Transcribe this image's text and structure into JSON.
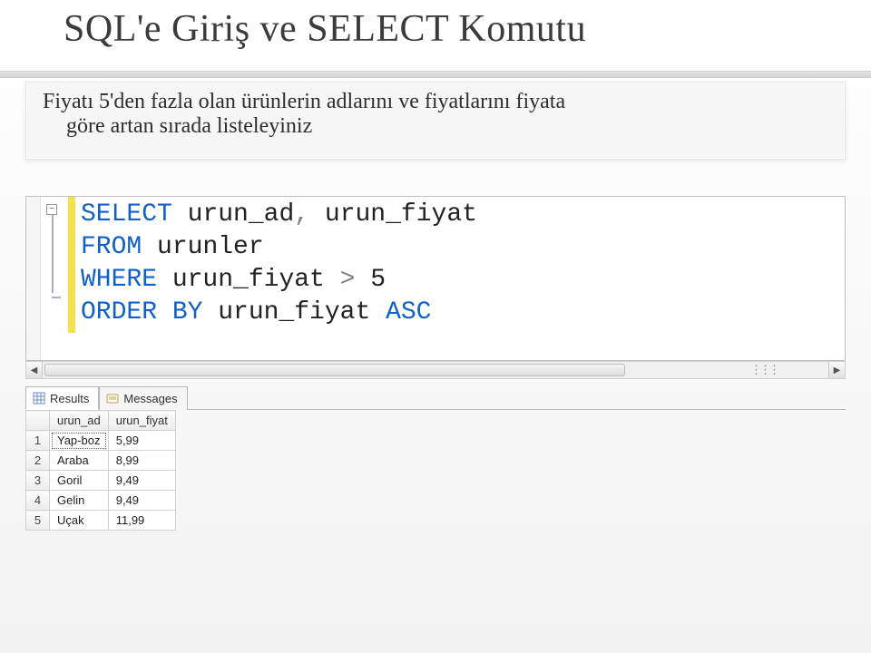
{
  "title": "SQL'e Giriş ve SELECT Komutu",
  "description": {
    "line1": "Fiyatı 5'den fazla olan ürünlerin adlarını ve fiyatlarını fiyata",
    "line2": "göre artan sırada listeleyiniz"
  },
  "sql": {
    "kw_select": "SELECT",
    "col1": "urun_ad",
    "comma": ",",
    "col2": "urun_fiyat",
    "kw_from": "FROM",
    "table": "urunler",
    "kw_where": "WHERE",
    "where_col": "urun_fiyat",
    "op": ">",
    "val": "5",
    "kw_orderby": "ORDER BY",
    "order_col": "urun_fiyat",
    "kw_asc": "ASC",
    "fold_symbol": "−"
  },
  "scroll": {
    "left_glyph": "◀",
    "right_glyph": "▶",
    "marks": "⋮⋮⋮"
  },
  "tabs": {
    "results": "Results",
    "messages": "Messages"
  },
  "grid": {
    "headers": {
      "c1": "urun_ad",
      "c2": "urun_fiyat"
    },
    "rows": [
      {
        "n": "1",
        "c1": "Yap-boz",
        "c2": "5,99"
      },
      {
        "n": "2",
        "c1": "Araba",
        "c2": "8,99"
      },
      {
        "n": "3",
        "c1": "Goril",
        "c2": "9,49"
      },
      {
        "n": "4",
        "c1": "Gelin",
        "c2": "9,49"
      },
      {
        "n": "5",
        "c1": "Uçak",
        "c2": "11,99"
      }
    ]
  }
}
